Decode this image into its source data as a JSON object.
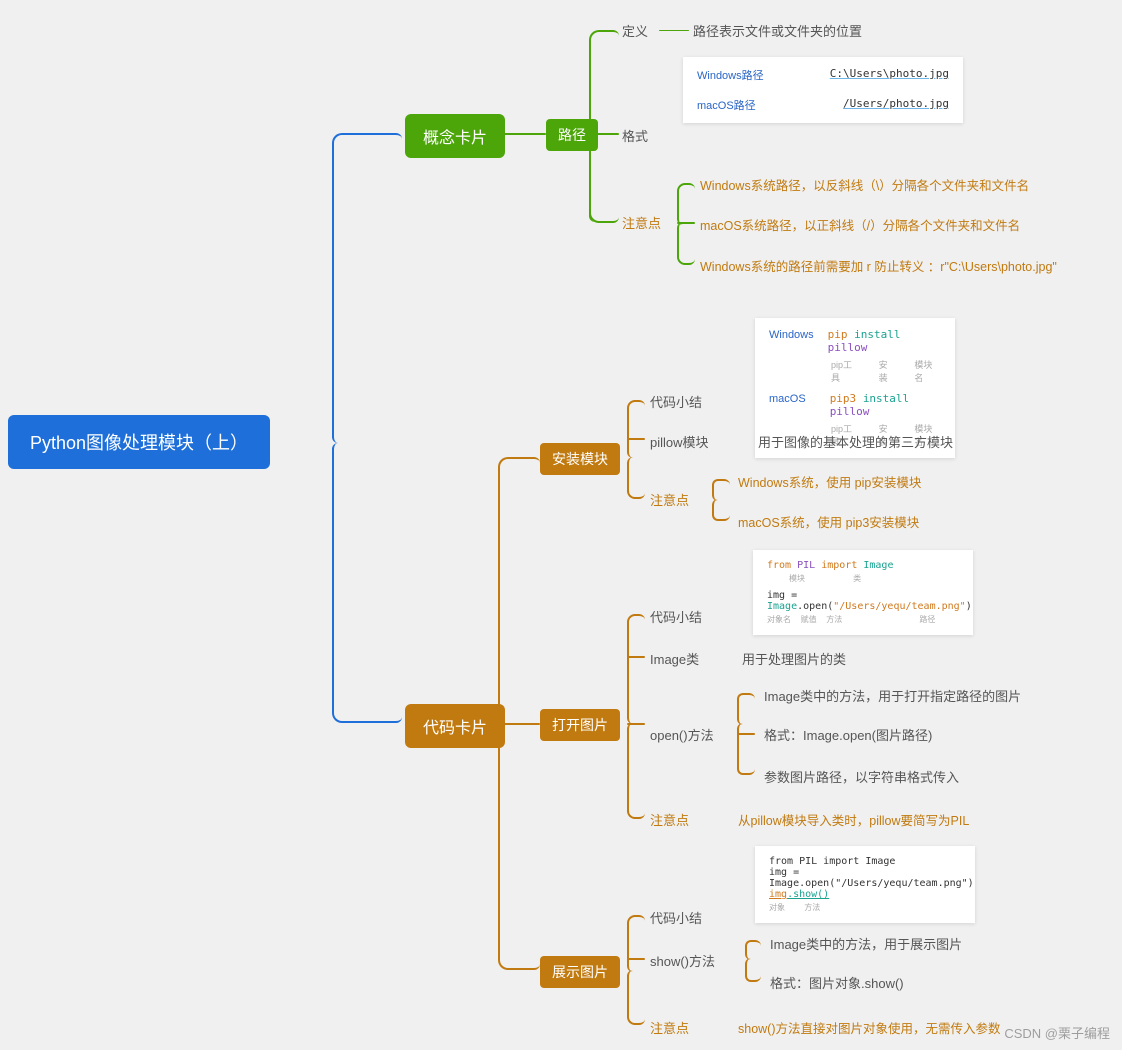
{
  "root": "Python图像处理模块（上）",
  "l1": {
    "concept": "概念卡片",
    "code": "代码卡片"
  },
  "concept": {
    "path": "路径",
    "def": {
      "label": "定义",
      "text": "路径表示文件或文件夹的位置"
    },
    "format": {
      "label": "格式"
    },
    "note": {
      "label": "注意点",
      "n1": "Windows系统路径，以反斜线（\\）分隔各个文件夹和文件名",
      "n2": "macOS系统路径，以正斜线（/）分隔各个文件夹和文件名",
      "n3": "Windows系统的路径前需要加 r 防止转义 ：r\"C:\\Users\\photo.jpg\""
    },
    "bill": {
      "winLabel": "Windows路径",
      "winVal": "C:\\Users\\photo.jpg",
      "macLabel": "macOS路径",
      "macVal": "/Users/photo.jpg"
    }
  },
  "code": {
    "install": {
      "label": "安装模块",
      "summary": {
        "label": "代码小结"
      },
      "pillow": {
        "label": "pillow模块",
        "text": "用于图像的基本处理的第三方模块"
      },
      "note": {
        "label": "注意点",
        "n1": "Windows系统，使用 pip安装模块",
        "n2": "macOS系统，使用 pip3安装模块"
      },
      "bill": {
        "winLabel": "Windows",
        "winPip": "pip",
        "winInstall": "install",
        "winPkg": "pillow",
        "macLabel": "macOS",
        "macPip": "pip3",
        "macInstall": "install",
        "macPkg": "pillow",
        "r1": "pip工具",
        "r2": "安装",
        "r3": "模块名"
      }
    },
    "open": {
      "label": "打开图片",
      "summary": {
        "label": "代码小结"
      },
      "imageClass": {
        "label": "Image类",
        "text": "用于处理图片的类"
      },
      "openMethod": {
        "label": "open()方法",
        "n1": "Image类中的方法，用于打开指定路径的图片",
        "n2": "格式：Image.open(图片路径)",
        "n3": "参数图片路径，以字符串格式传入"
      },
      "note": {
        "label": "注意点",
        "text": "从pillow模块导入类时，pillow要简写为PIL"
      },
      "bill": {
        "line1a": "from",
        "line1b": "PIL",
        "line1c": "import",
        "line1d": "Image",
        "r1": "模块",
        "r2": "类",
        "line2a": "img",
        "line2b": "=",
        "line2c": "Image",
        "line2d": ".open(",
        "line2e": "\"/Users/yequ/team.png\"",
        "line2f": ")",
        "r3": "对象名",
        "r4": "赋值",
        "r5": "方法",
        "r6": "路径"
      }
    },
    "show": {
      "label": "展示图片",
      "summary": {
        "label": "代码小结"
      },
      "showMethod": {
        "label": "show()方法",
        "n1": "Image类中的方法，用于展示图片",
        "n2": "格式：图片对象.show()"
      },
      "note": {
        "label": "注意点",
        "text": "show()方法直接对图片对象使用，无需传入参数"
      },
      "bill": {
        "l1": "from PIL import Image",
        "l2": "img = Image.open(\"/Users/yequ/team.png\")",
        "l3a": "img",
        "l3b": ".show()",
        "r1": "对象",
        "r2": "方法"
      }
    }
  },
  "watermark": "CSDN @栗子编程"
}
